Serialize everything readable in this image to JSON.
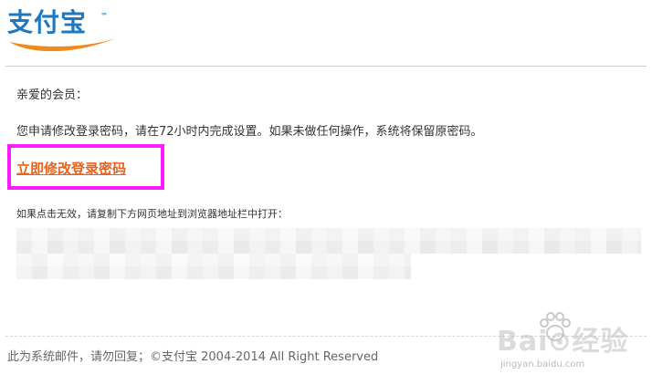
{
  "header": {
    "logo_text": "支付宝",
    "logo_tm": "™"
  },
  "email": {
    "greeting": "亲爱的会员：",
    "message": "您申请修改登录密码，请在72小时内完成设置。如果未做任何操作，系统将保留原密码。",
    "reset_link": "立即修改登录密码",
    "fallback_hint": "如果点击无效，请复制下方网页地址到浏览器地址栏中打开："
  },
  "footer": {
    "text": "此为系统邮件，请勿回复；©支付宝 2004-2014 All Right Reserved"
  },
  "watermark": {
    "brand": "Bai⊙经验",
    "sub": "jingyan.baidu.com"
  },
  "colors": {
    "logo_blue": "#1d78bf",
    "logo_orange": "#f08a1c",
    "link_orange": "#e8621c",
    "highlight_magenta": "#ff1aff"
  }
}
